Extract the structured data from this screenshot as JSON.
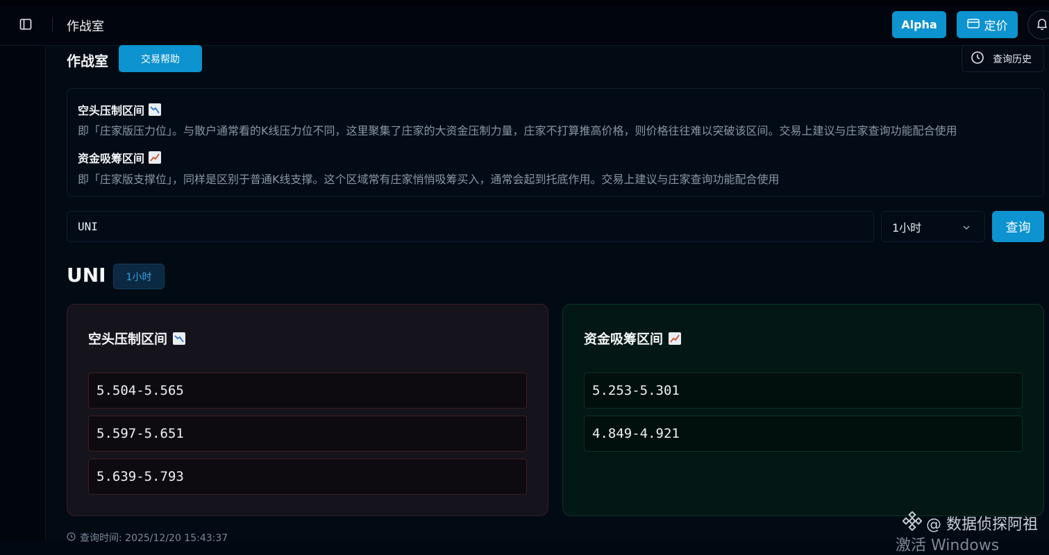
{
  "topbar": {
    "title": "作战室",
    "alpha_label": "Alpha",
    "pricing_label": "定价"
  },
  "page": {
    "heading": "作战室",
    "help_label": "交易帮助",
    "history_label": "查询历史"
  },
  "info": {
    "resistance_title": "空头压制区间",
    "resistance_desc": "即「庄家版压力位」。与散户通常看的K线压力位不同，这里聚集了庄家的大资金压制力量，庄家不打算推高价格，则价格往往难以突破该区间。交易上建议与庄家查询功能配合使用",
    "support_title": "资金吸筹区间",
    "support_desc": "即「庄家版支撑位」，同样是区别于普通K线支撑。这个区域常有庄家悄悄吸筹买入，通常会起到托底作用。交易上建议与庄家查询功能配合使用"
  },
  "search": {
    "value": "UNI",
    "interval": "1小时",
    "query_label": "查询"
  },
  "result": {
    "symbol": "UNI",
    "interval_badge": "1小时",
    "resistance": {
      "title": "空头压制区间",
      "zones": [
        "5.504-5.565",
        "5.597-5.651",
        "5.639-5.793"
      ]
    },
    "support": {
      "title": "资金吸筹区间",
      "zones": [
        "5.253-5.301",
        "4.849-4.921"
      ]
    },
    "query_time": "查询时间: 2025/12/20 15:43:37"
  },
  "overlay": {
    "watermark": "@ 数据侦探阿祖",
    "activate": "激活 Windows"
  },
  "colors": {
    "accent": "#0d93cf",
    "resistance_border": "#3a1e22",
    "support_border": "#0e3427"
  }
}
